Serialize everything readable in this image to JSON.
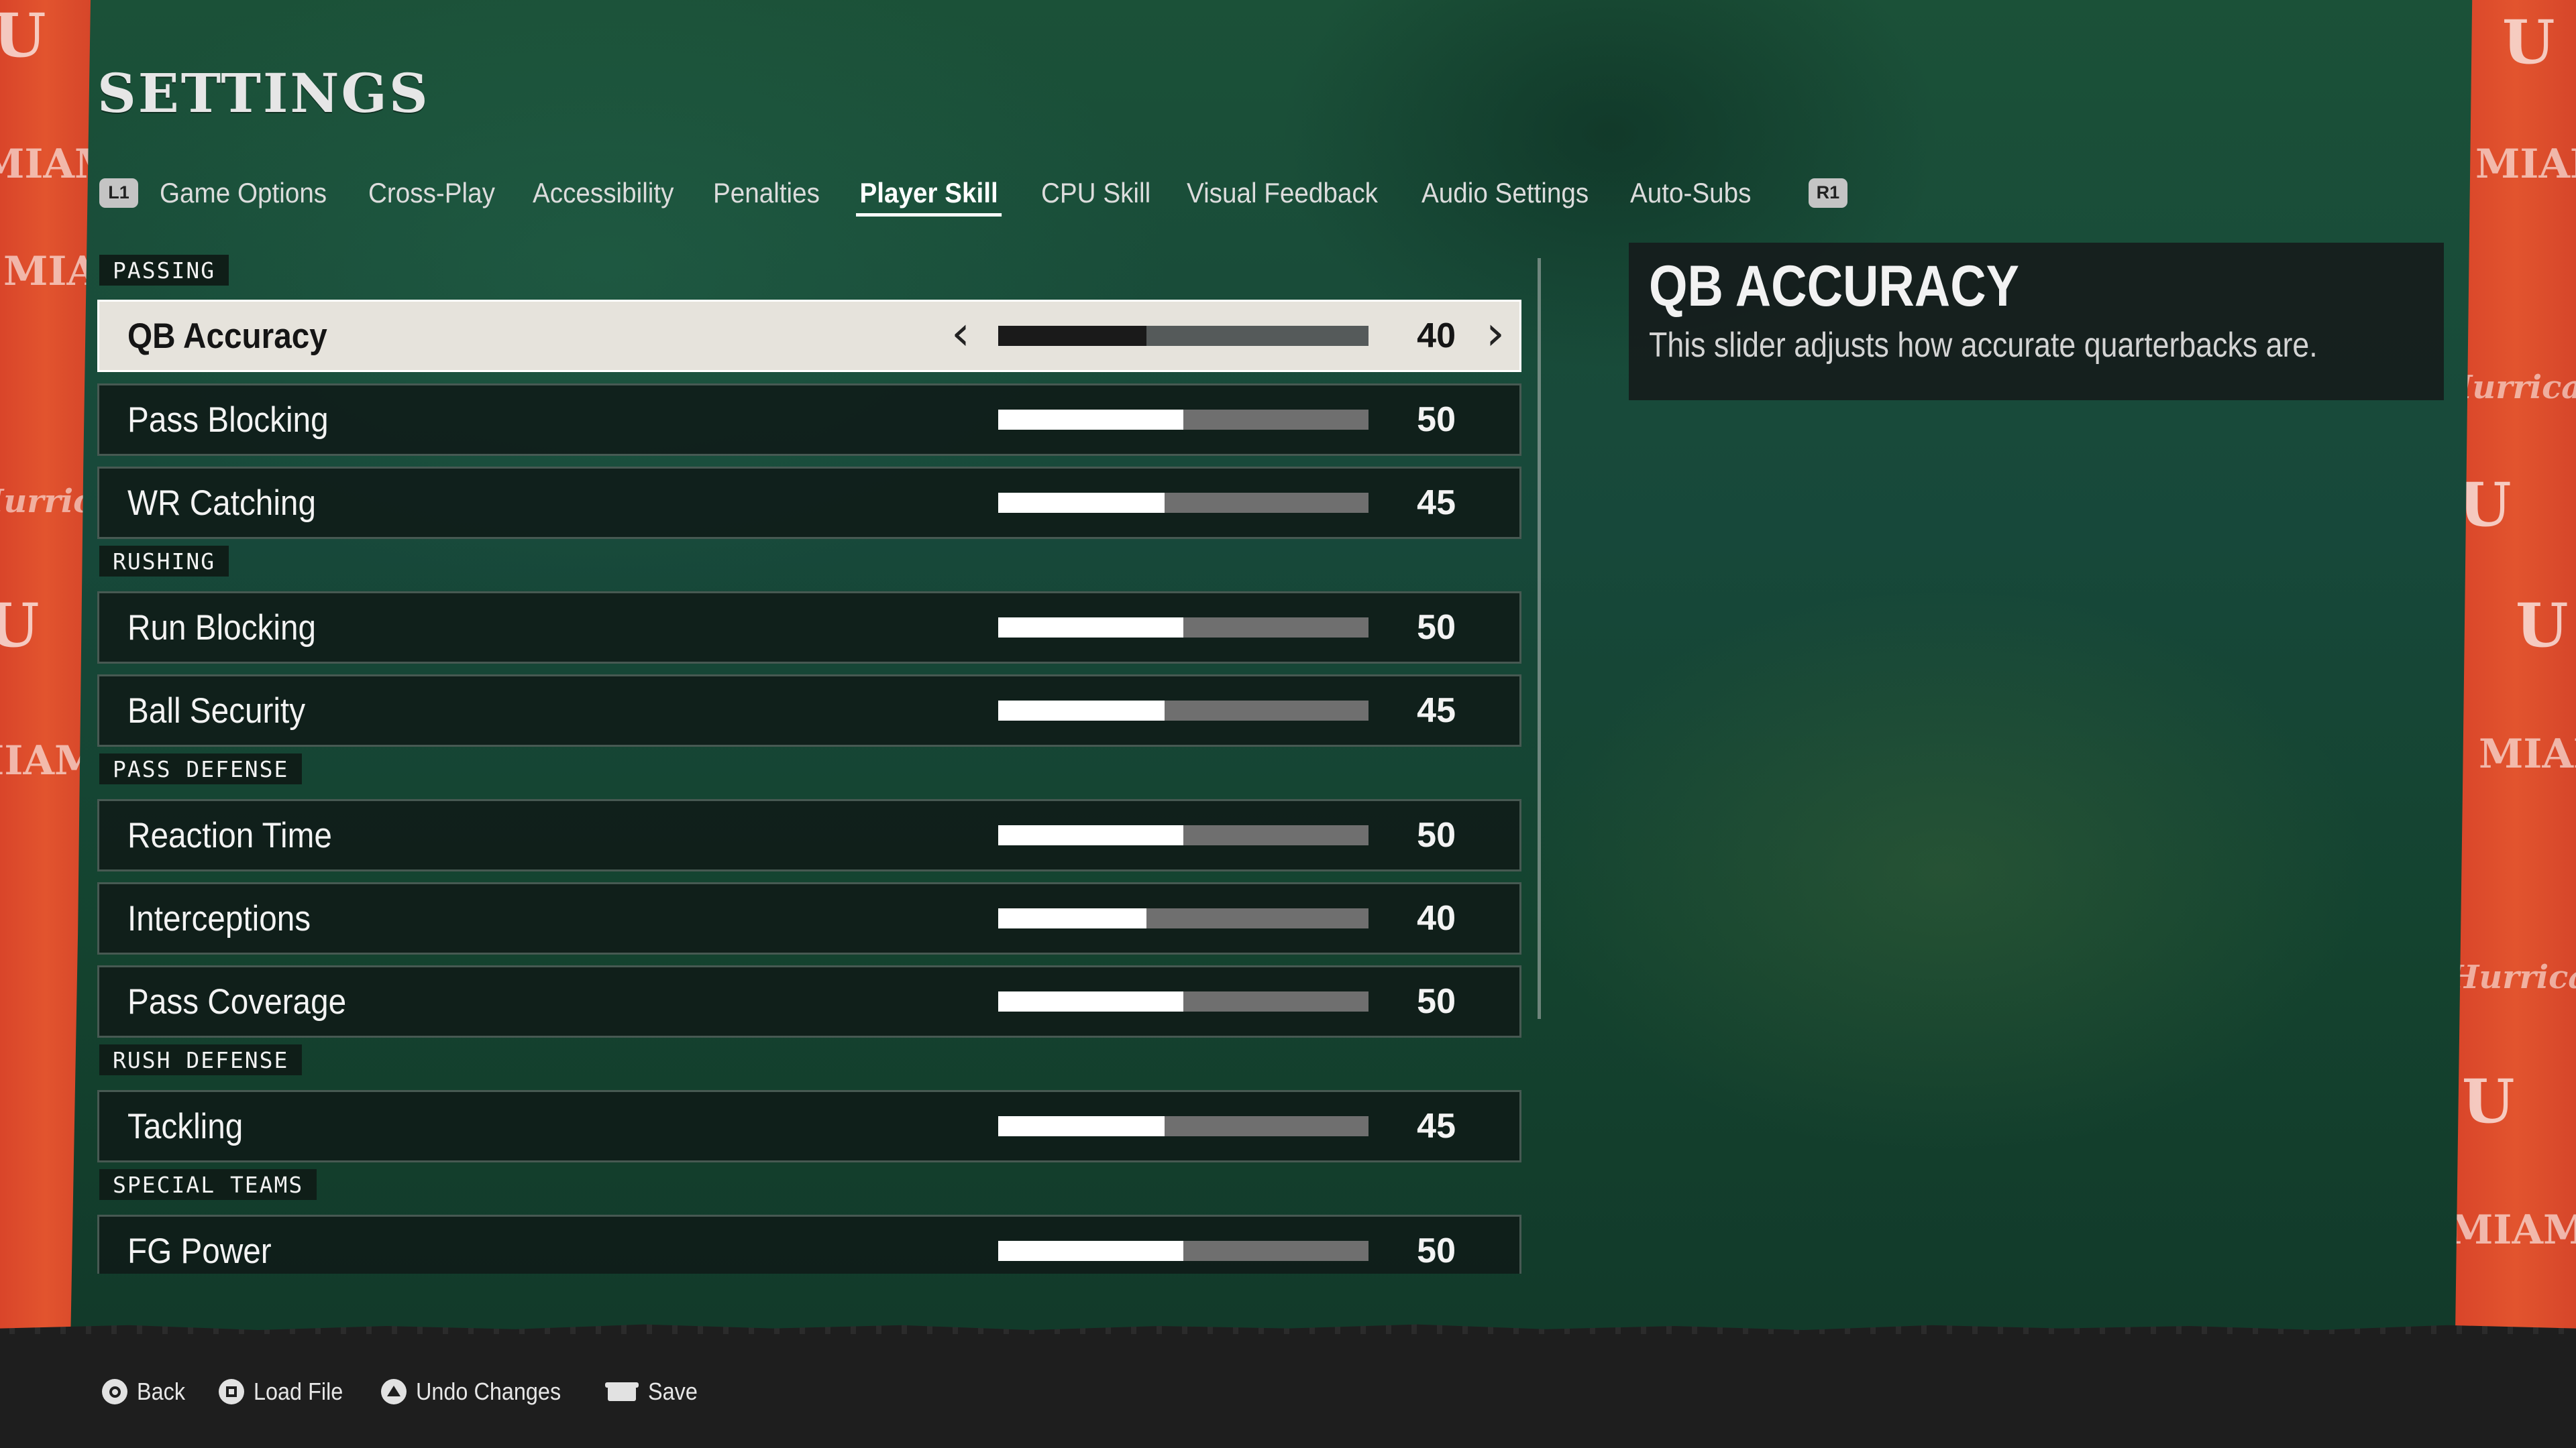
{
  "header": {
    "title": "SETTINGS"
  },
  "tabs": {
    "left_shoulder": "L1",
    "right_shoulder": "R1",
    "items": [
      {
        "label": "Game Options"
      },
      {
        "label": "Cross-Play"
      },
      {
        "label": "Accessibility"
      },
      {
        "label": "Penalties"
      },
      {
        "label": "Player Skill",
        "active": true
      },
      {
        "label": "CPU Skill"
      },
      {
        "label": "Visual Feedback"
      },
      {
        "label": "Audio Settings"
      },
      {
        "label": "Auto-Subs"
      }
    ]
  },
  "sections": [
    {
      "label": "PASSING"
    },
    {
      "label": "RUSHING"
    },
    {
      "label": "PASS DEFENSE"
    },
    {
      "label": "RUSH DEFENSE"
    },
    {
      "label": "SPECIAL TEAMS"
    }
  ],
  "sliders": [
    {
      "label": "QB Accuracy",
      "value": "40",
      "level": 0.4,
      "selected": true,
      "section": 0
    },
    {
      "label": "Pass Blocking",
      "value": "50",
      "level": 0.5,
      "section": 0
    },
    {
      "label": "WR Catching",
      "value": "45",
      "level": 0.45,
      "section": 0
    },
    {
      "label": "Run Blocking",
      "value": "50",
      "level": 0.5,
      "section": 1
    },
    {
      "label": "Ball Security",
      "value": "45",
      "level": 0.45,
      "section": 1
    },
    {
      "label": "Reaction Time",
      "value": "50",
      "level": 0.5,
      "section": 2
    },
    {
      "label": "Interceptions",
      "value": "40",
      "level": 0.4,
      "section": 2
    },
    {
      "label": "Pass Coverage",
      "value": "50",
      "level": 0.5,
      "section": 2
    },
    {
      "label": "Tackling",
      "value": "45",
      "level": 0.45,
      "section": 3
    },
    {
      "label": "FG Power",
      "value": "50",
      "level": 0.5,
      "section": 4
    }
  ],
  "info": {
    "title": "QB ACCURACY",
    "description": "This slider adjusts how accurate quarterbacks are."
  },
  "footer": {
    "actions": [
      {
        "label": "Back",
        "icon": "circle-button-icon"
      },
      {
        "label": "Load File",
        "icon": "square-button-icon"
      },
      {
        "label": "Undo Changes",
        "icon": "triangle-button-icon"
      },
      {
        "label": "Save",
        "icon": "touchpad-button-icon"
      }
    ]
  },
  "decor": {
    "u": "U",
    "miami": "MIAMI",
    "hurricanes": "Hurricanes"
  },
  "colors": {
    "background_green": "#16412f",
    "team_orange": "#e2542e",
    "selected_row": "#e6e3dc",
    "slider_fill": "#ffffff",
    "slider_track": "#6f6f6f",
    "footer": "#1e1e1e"
  }
}
